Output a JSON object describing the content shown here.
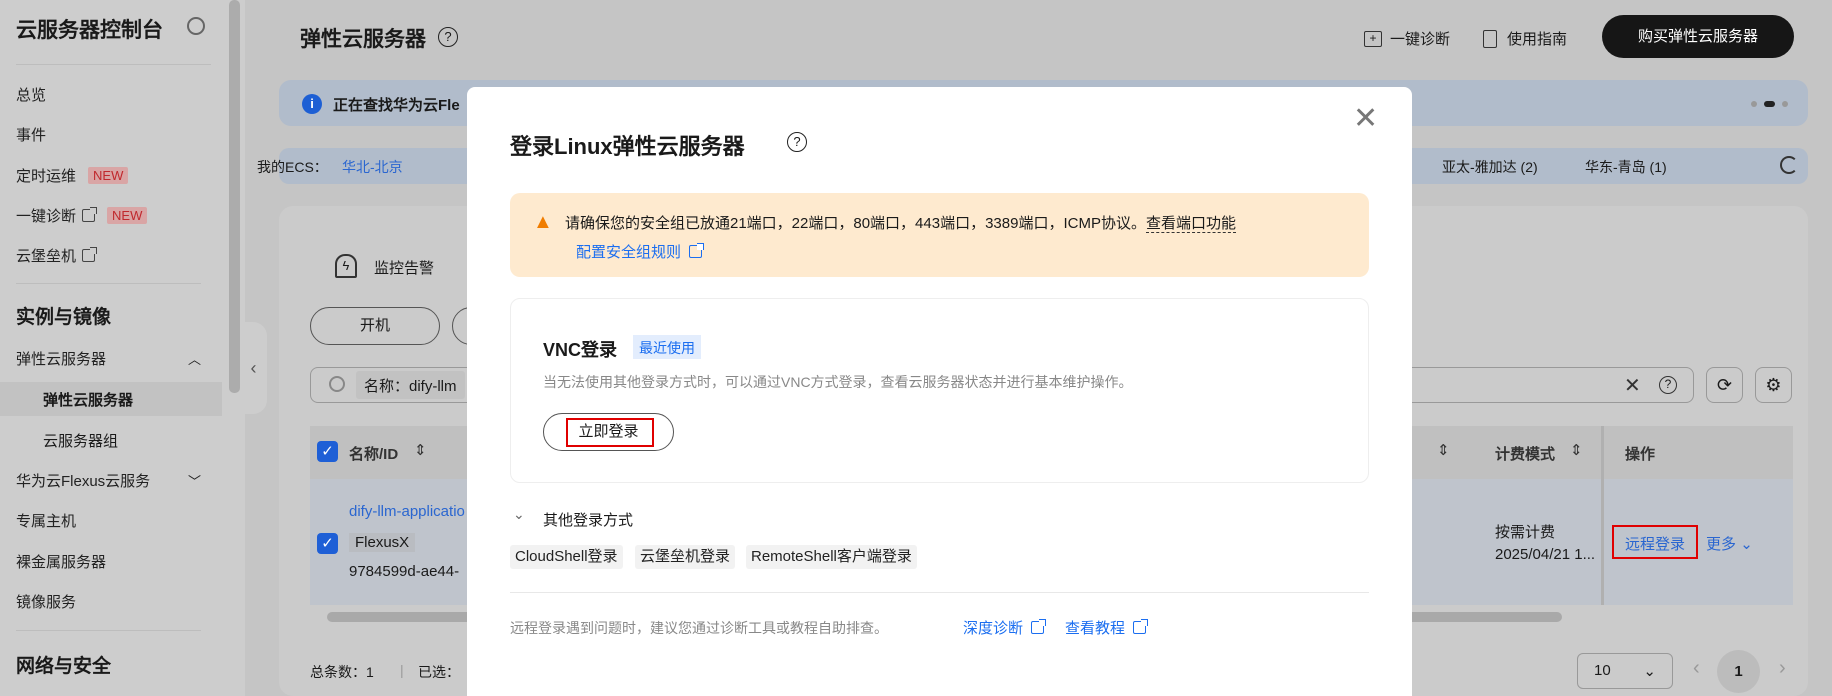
{
  "sidebar": {
    "title": "云服务器控制台",
    "items": [
      {
        "label": "总览"
      },
      {
        "label": "事件"
      },
      {
        "label": "定时运维",
        "badge": "NEW"
      },
      {
        "label": "一键诊断",
        "badge": "NEW"
      },
      {
        "label": "云堡垒机"
      }
    ],
    "section1": "实例与镜像",
    "ecs_group": "弹性云服务器",
    "ecs_sub": [
      "弹性云服务器",
      "云服务器组"
    ],
    "more_items": [
      "华为云Flexus云服务",
      "专属主机",
      "裸金属服务器",
      "镜像服务"
    ],
    "section2": "网络与安全"
  },
  "header": {
    "title": "弹性云服务器",
    "diagnose": "一键诊断",
    "guide": "使用指南",
    "buy": "购买弹性云服务器"
  },
  "banner": {
    "text": "正在查找华为云Fle"
  },
  "regions": {
    "label": "我的ECS：",
    "items": [
      "华北-北京",
      "亚太-雅加达 (2)",
      "华东-青岛 (1)"
    ]
  },
  "toolbar": {
    "monitor": "监控告警",
    "start": "开机"
  },
  "search": {
    "filter": "名称：dify-llm"
  },
  "table": {
    "headers": {
      "name": "名称/ID",
      "billing": "计费模式",
      "ops": "操作"
    },
    "row": {
      "name": "dify-llm-applicatio",
      "tag": "FlexusX",
      "id": "9784599d-ae44-",
      "billing": "按需计费",
      "date": "2025/04/21 1...",
      "remote": "远程登录",
      "more": "更多"
    }
  },
  "footer": {
    "total": "总条数：1",
    "selected": "已选：",
    "page_size": "10",
    "page": "1"
  },
  "modal": {
    "title": "登录Linux弹性云服务器",
    "alert": "请确保您的安全组已放通21端口，22端口，80端口，443端口，3389端口，ICMP协议。",
    "alert_link": "查看端口功能",
    "config_link": "配置安全组规则",
    "vnc_title": "VNC登录",
    "vnc_badge": "最近使用",
    "vnc_desc": "当无法使用其他登录方式时，可以通过VNC方式登录，查看云服务器状态并进行基本维护操作。",
    "vnc_button": "立即登录",
    "other_title": "其他登录方式",
    "other_methods": [
      "CloudShell登录",
      "云堡垒机登录",
      "RemoteShell客户端登录"
    ],
    "help_text": "远程登录遇到问题时，建议您通过诊断工具或教程自助排查。",
    "deep_diag": "深度诊断",
    "tutorial": "查看教程"
  }
}
